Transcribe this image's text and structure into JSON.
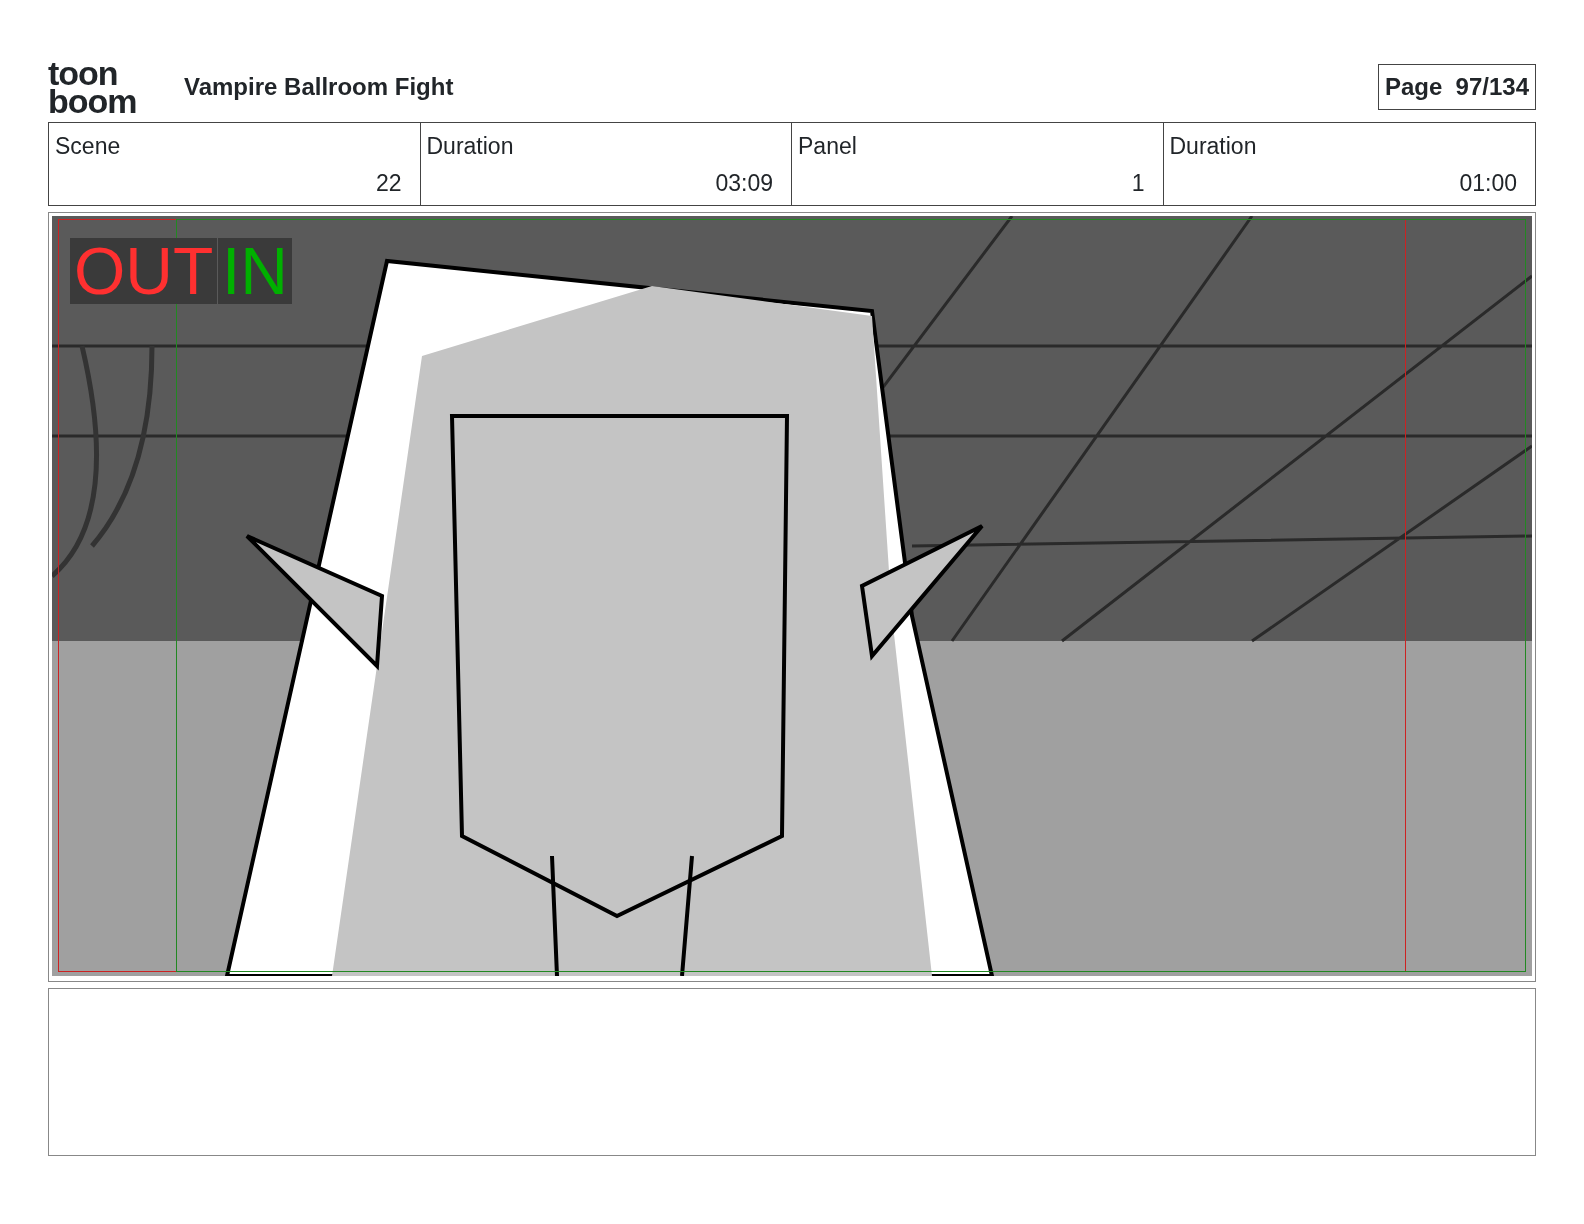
{
  "logo": {
    "lines": [
      "toon",
      "boom"
    ]
  },
  "title": "Vampire Ballroom Fight",
  "page": {
    "label": "Page",
    "value": "97/134"
  },
  "fields": [
    {
      "label": "Scene",
      "value": "22"
    },
    {
      "label": "Duration",
      "value": "03:09"
    },
    {
      "label": "Panel",
      "value": "1"
    },
    {
      "label": "Duration",
      "value": "01:00"
    }
  ],
  "panel": {
    "markers": [
      {
        "text": "OUT",
        "kind": "out"
      },
      {
        "text": "IN",
        "kind": "in"
      }
    ]
  }
}
